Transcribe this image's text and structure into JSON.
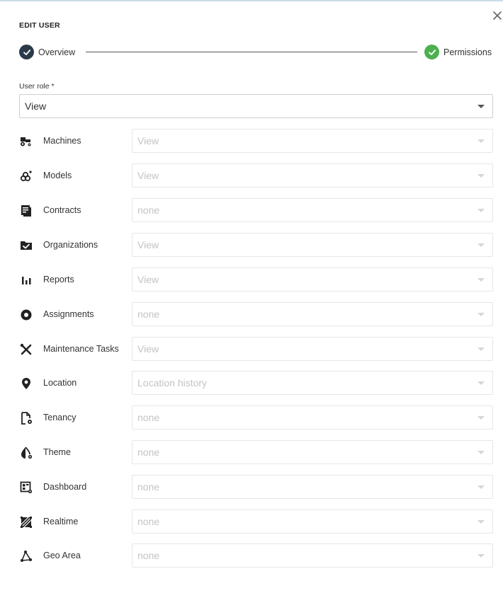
{
  "dialog": {
    "title": "EDIT USER",
    "close_icon": "close-icon"
  },
  "stepper": {
    "steps": [
      {
        "label": "Overview",
        "color": "#2b3a4a",
        "icon": "check-icon"
      },
      {
        "label": "Permissions",
        "color": "#4caf50",
        "icon": "check-icon"
      }
    ]
  },
  "user_role": {
    "label": "User role *",
    "value": "View"
  },
  "permissions": [
    {
      "name": "Machines",
      "value": "View",
      "icon": "tractor-icon"
    },
    {
      "name": "Models",
      "value": "View",
      "icon": "models-icon"
    },
    {
      "name": "Contracts",
      "value": "none",
      "icon": "contract-icon"
    },
    {
      "name": "Organizations",
      "value": "View",
      "icon": "folder-check-icon"
    },
    {
      "name": "Reports",
      "value": "View",
      "icon": "bar-chart-icon"
    },
    {
      "name": "Assignments",
      "value": "none",
      "icon": "assignment-icon"
    },
    {
      "name": "Maintenance Tasks",
      "value": "View",
      "icon": "tools-icon"
    },
    {
      "name": "Location",
      "value": "Location history",
      "icon": "location-pin-icon"
    },
    {
      "name": "Tenancy",
      "value": "none",
      "icon": "file-settings-icon"
    },
    {
      "name": "Theme",
      "value": "none",
      "icon": "theme-icon"
    },
    {
      "name": "Dashboard",
      "value": "none",
      "icon": "dashboard-icon"
    },
    {
      "name": "Realtime",
      "value": "none",
      "icon": "realtime-icon"
    },
    {
      "name": "Geo Area",
      "value": "none",
      "icon": "polygon-icon"
    }
  ]
}
